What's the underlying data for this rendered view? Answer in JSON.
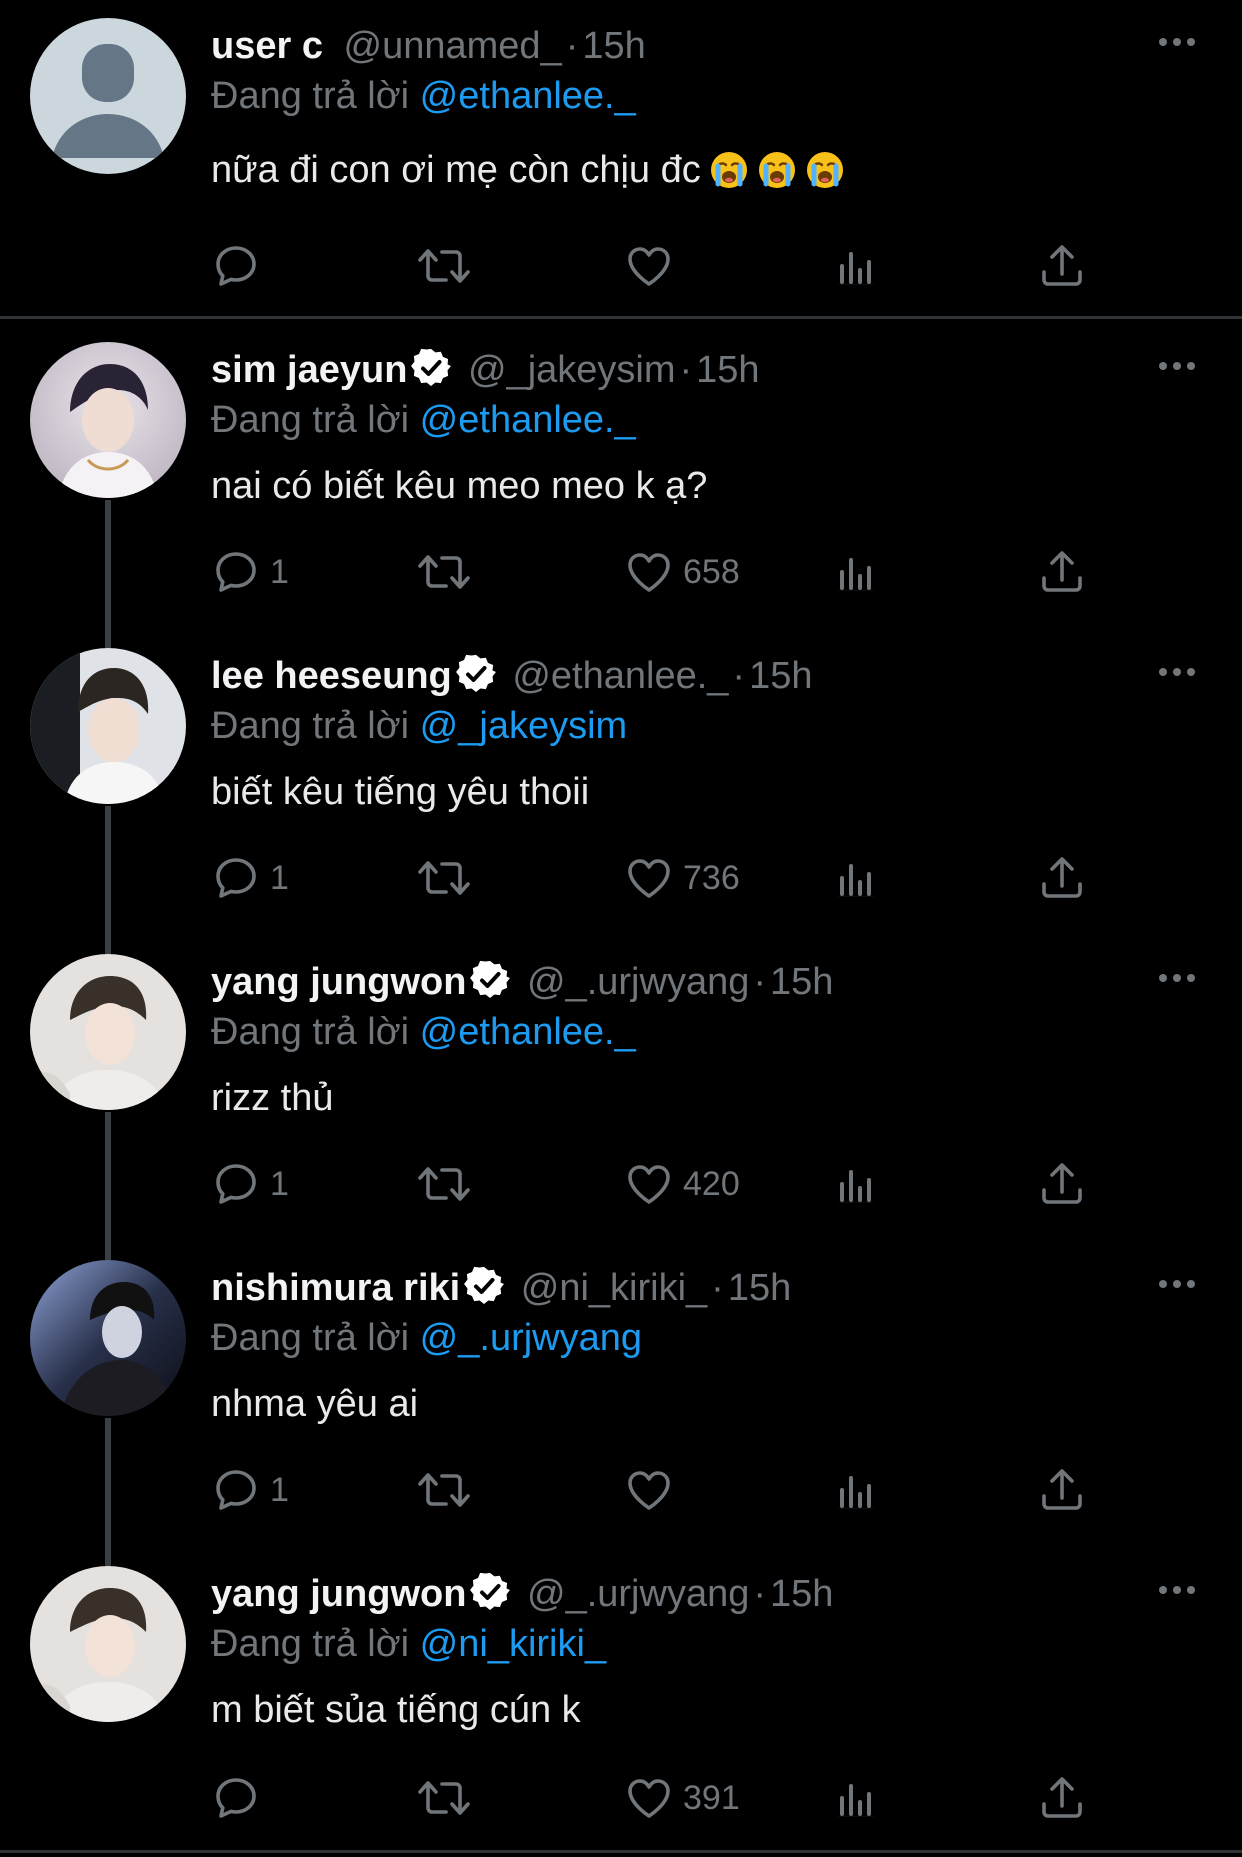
{
  "replying_label": "Đang trả lời",
  "tweets": [
    {
      "name": "user c",
      "handle": "@unnamed_",
      "time": "15h",
      "replying_to": "@ethanlee._",
      "text": "nữa đi con ơi mẹ còn chịu đc",
      "emojis": [
        "loudly-crying-face",
        "loudly-crying-face",
        "loudly-crying-face"
      ],
      "verified": false,
      "replies": "",
      "likes": ""
    },
    {
      "name": "sim jaeyun",
      "handle": "@_jakeysim",
      "time": "15h",
      "replying_to": "@ethanlee._",
      "text": "nai có biết kêu meo meo k ạ?",
      "verified": true,
      "replies": "1",
      "likes": "658"
    },
    {
      "name": "lee heeseung",
      "handle": "@ethanlee._",
      "time": "15h",
      "replying_to": "@_jakeysim",
      "text": "biết kêu tiếng yêu thoii",
      "verified": true,
      "replies": "1",
      "likes": "736"
    },
    {
      "name": "yang jungwon",
      "handle": "@_.urjwyang",
      "time": "15h",
      "replying_to": "@ethanlee._",
      "text": "rizz thủ",
      "verified": true,
      "replies": "1",
      "likes": "420"
    },
    {
      "name": "nishimura riki",
      "handle": "@ni_kiriki_",
      "time": "15h",
      "replying_to": "@_.urjwyang",
      "text": "nhma yêu ai",
      "verified": true,
      "replies": "1",
      "likes": ""
    },
    {
      "name": "yang jungwon",
      "handle": "@_.urjwyang",
      "time": "15h",
      "replying_to": "@ni_kiriki_",
      "text": "m biết sủa tiếng cún k",
      "verified": true,
      "replies": "",
      "likes": "391"
    }
  ],
  "colors": {
    "background": "#000000",
    "text": "#e7e9ea",
    "muted": "#71767b",
    "link": "#1d9bf0",
    "divider": "#2f3336"
  }
}
